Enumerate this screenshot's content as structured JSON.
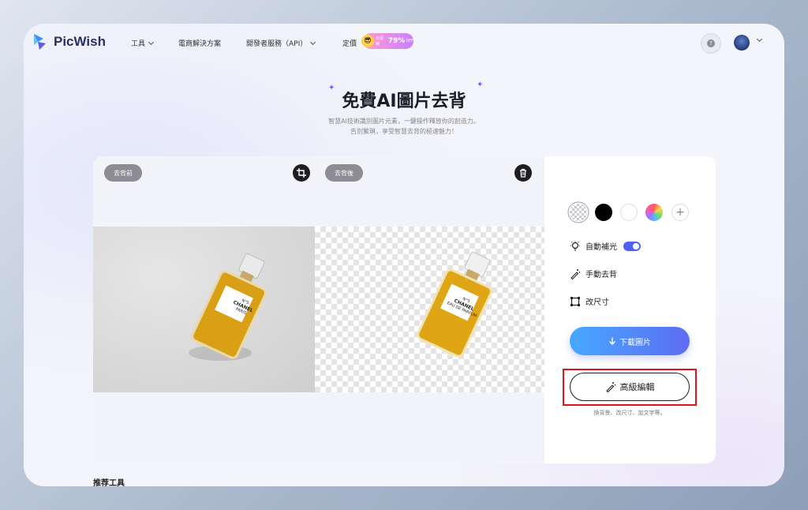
{
  "brand": {
    "name": "PicWish"
  },
  "nav": {
    "items": [
      {
        "label": "工具",
        "has_dropdown": true
      },
      {
        "label": "電商解決方案",
        "has_dropdown": false
      },
      {
        "label": "開發者服務（API）",
        "has_dropdown": true
      },
      {
        "label": "定價",
        "has_dropdown": false
      }
    ],
    "promo": {
      "small_text": "大促销",
      "percent": "79%",
      "suffix": "OFF"
    }
  },
  "hero": {
    "title": "免費AI圖片去背",
    "subtitle_line1": "智慧AI技術識別圖片元素，一鍵操作釋放你的創造力。",
    "subtitle_line2": "告別繁瑣，享受智慧去背的極速魅力！"
  },
  "editor": {
    "before_label": "去背前",
    "after_label": "去背後",
    "bottle_label_top": "N°5",
    "bottle_label_brand": "CHANEL",
    "bottle_label_sub": "PARIS",
    "bottle_label_bottom": "EAU DE PARFUM"
  },
  "options": {
    "swatches": [
      "transparent",
      "#000000",
      "#ffffff",
      "rainbow",
      "add"
    ],
    "auto_light_label": "自動補光",
    "auto_light_enabled": true,
    "manual_label": "手動去背",
    "resize_label": "改尺寸"
  },
  "actions": {
    "download_label": "下載圖片",
    "advanced_label": "高級編輯",
    "advanced_note": "換背景、改尺寸、加文字等。"
  },
  "footer": {
    "recommended_tools": "推荐工具"
  },
  "colors": {
    "accent": "#4e63f5",
    "highlight": "#e0121b",
    "brand_text": "#2b2f66"
  }
}
